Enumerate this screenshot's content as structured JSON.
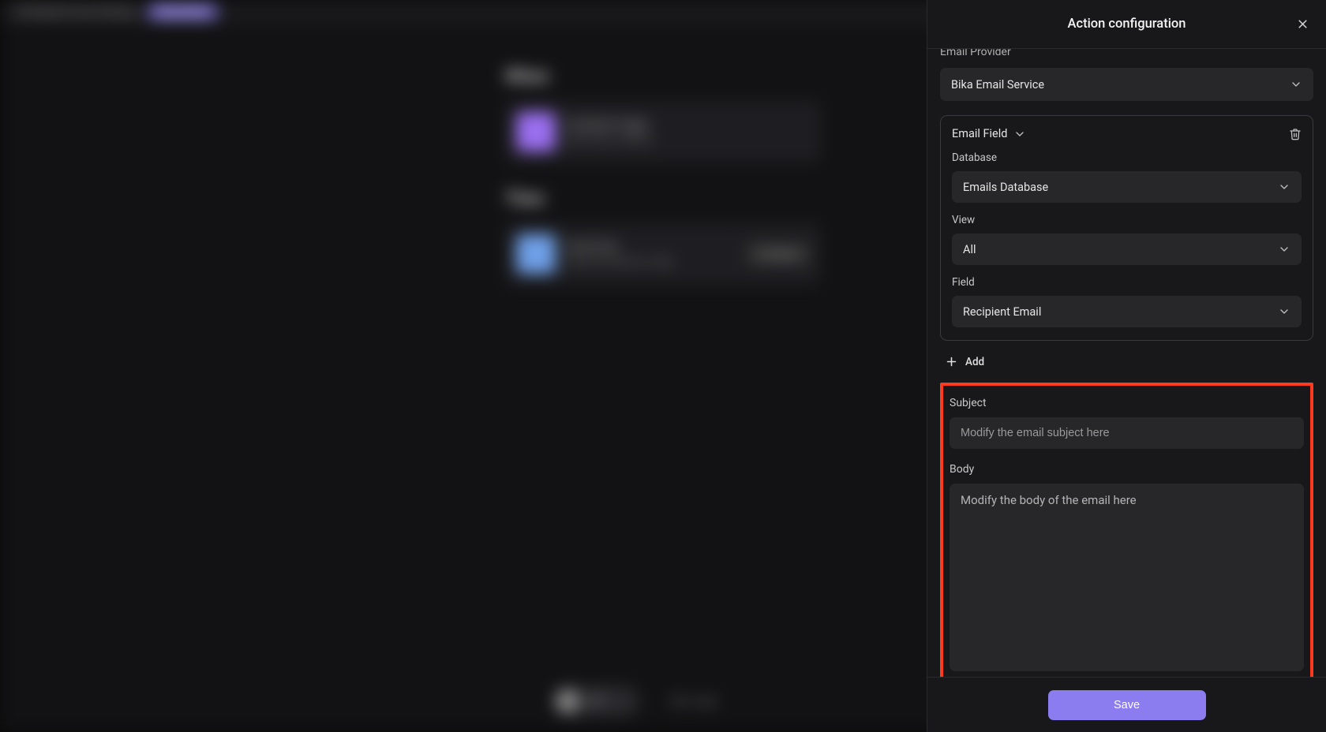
{
  "bg": {
    "header_title": "Bi-Weekly Email Sending",
    "header_badge": "Automation",
    "section1_title": "When",
    "section2_title": "Then",
    "card1_line1": "Scheduled Trigger",
    "card1_line2": "Run Every 2 Weeks",
    "card2_line1": "Send Email",
    "card2_line2": "Send all emails in a day",
    "card2_pill": "Configure",
    "toggle_label": "OFF",
    "bottom_text": "Run Logs"
  },
  "panel": {
    "title": "Action configuration",
    "email_provider_label": "Email Provider",
    "email_provider_value": "Bika Email Service",
    "email_field_title": "Email Field",
    "database_label": "Database",
    "database_value": "Emails Database",
    "view_label": "View",
    "view_value": "All",
    "field_label": "Field",
    "field_value": "Recipient Email",
    "add_label": "Add",
    "subject_label": "Subject",
    "subject_placeholder": "Modify the email subject here",
    "body_label": "Body",
    "body_placeholder": "Modify the body of the email here",
    "save_label": "Save"
  }
}
